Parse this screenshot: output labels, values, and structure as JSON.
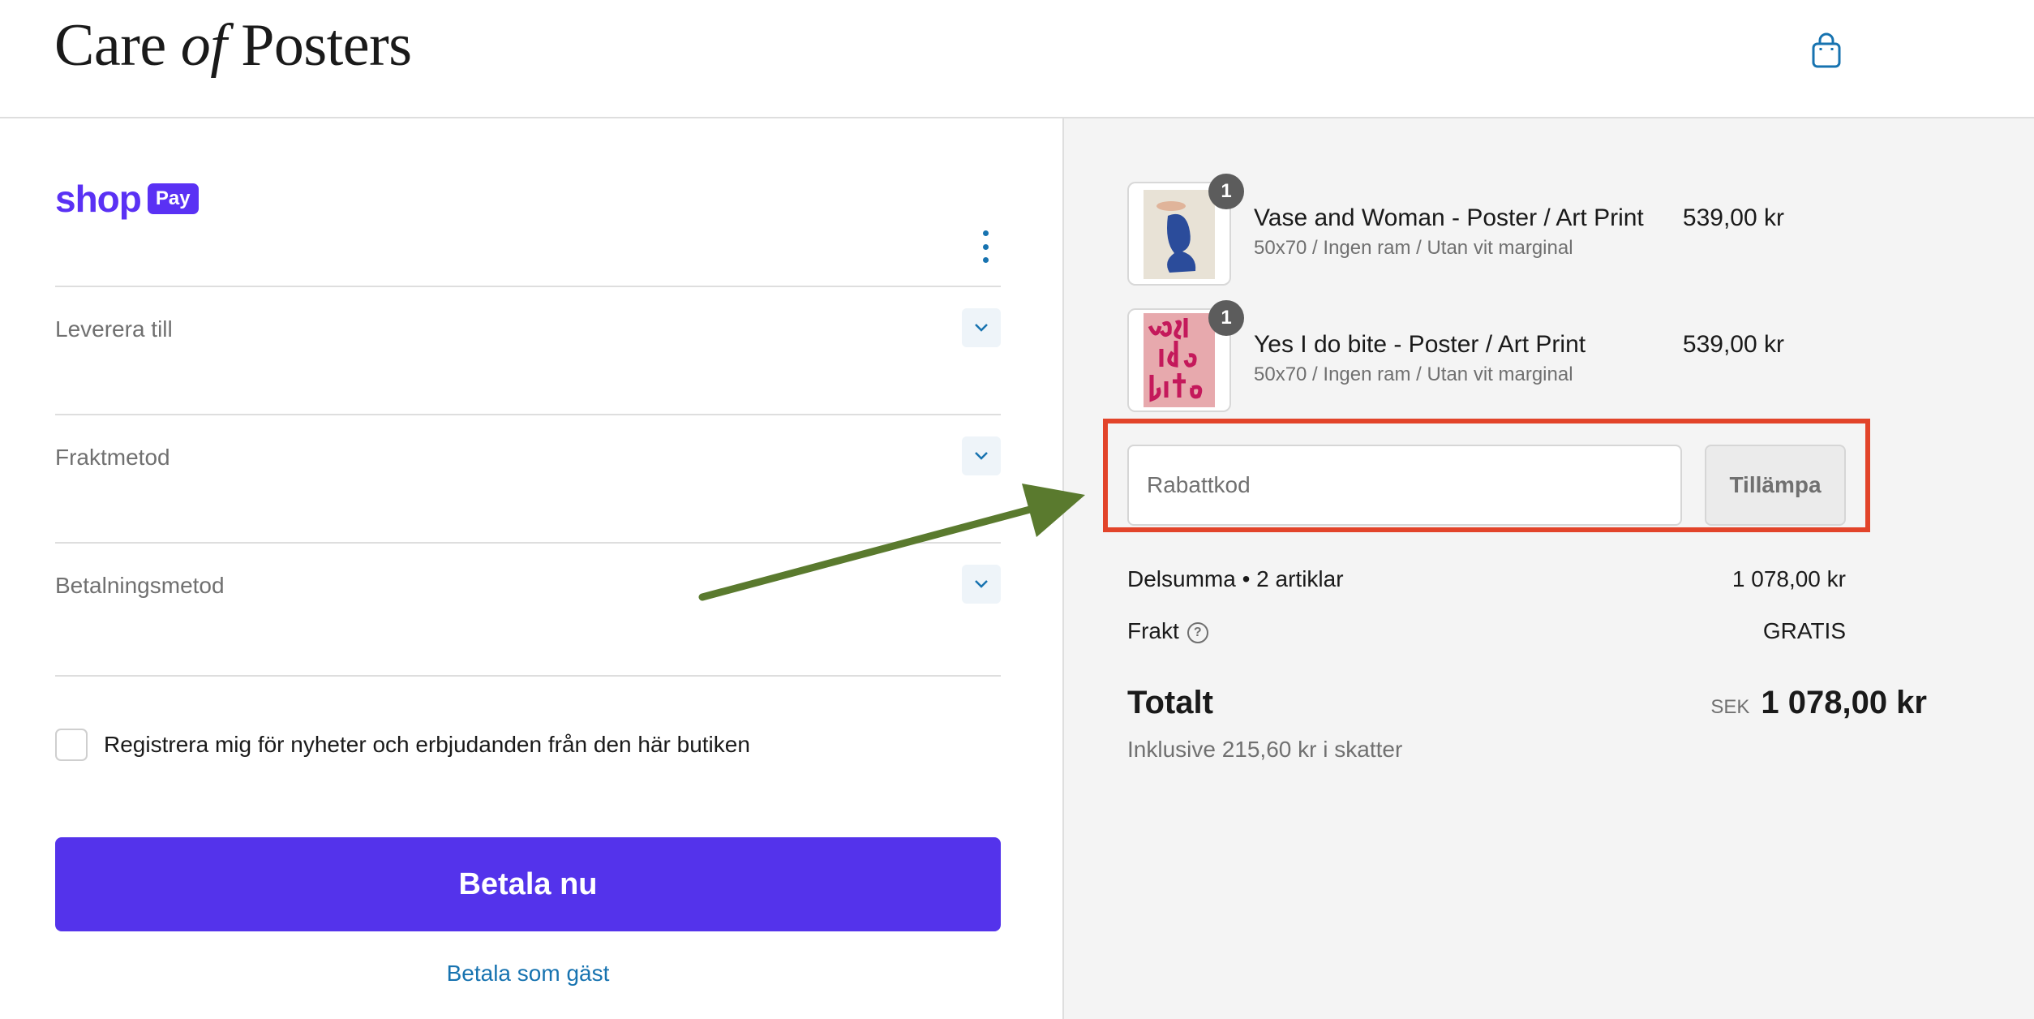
{
  "header": {
    "logo_part1": "Care",
    "logo_part2": "of",
    "logo_part3": "Posters",
    "bag_icon": "shopping-bag-icon"
  },
  "checkout": {
    "shop_pay": {
      "brand": "shop",
      "badge": "Pay"
    },
    "sections": [
      {
        "label": "Leverera till"
      },
      {
        "label": "Fraktmetod"
      },
      {
        "label": "Betalningsmetod"
      }
    ],
    "newsletter_label": "Registrera mig för nyheter och erbjudanden från den här butiken",
    "pay_button": "Betala nu",
    "guest_link": "Betala som gäst"
  },
  "summary": {
    "items": [
      {
        "qty": "1",
        "name": "Vase and Woman - Poster / Art Print",
        "variant": "50x70 / Ingen ram / Utan vit marginal",
        "price": "539,00 kr"
      },
      {
        "qty": "1",
        "name": "Yes I do bite - Poster / Art Print",
        "variant": "50x70 / Ingen ram / Utan vit marginal",
        "price": "539,00 kr"
      }
    ],
    "discount": {
      "placeholder": "Rabattkod",
      "apply_label": "Tillämpa"
    },
    "subtotal_label": "Delsumma • 2 artiklar",
    "subtotal_value": "1 078,00 kr",
    "shipping_label": "Frakt",
    "shipping_value": "GRATIS",
    "total_label": "Totalt",
    "currency": "SEK",
    "total_value": "1 078,00 kr",
    "tax_note": "Inklusive 215,60 kr i skatter"
  },
  "colors": {
    "brand_purple": "#5433eb",
    "link_blue": "#1773b0",
    "highlight_red": "#e2442a",
    "arrow_green": "#5a7a2e"
  }
}
